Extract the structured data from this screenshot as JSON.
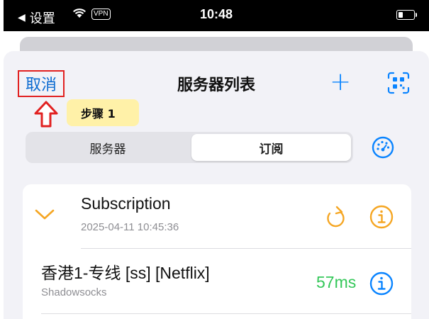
{
  "status_bar": {
    "back_label": "设置",
    "vpn_label": "VPN",
    "time": "10:48",
    "icons": [
      "back-triangle-icon",
      "wifi-icon",
      "vpn-icon",
      "battery-icon"
    ]
  },
  "nav": {
    "cancel_label": "取消",
    "title": "服务器列表",
    "add_icon": "plus-icon",
    "qr_icon": "qr-scan-icon"
  },
  "annotation": {
    "step_label": "步骤 1",
    "arrow_icon": "arrow-up-outline-icon",
    "highlight_color": "#e12121",
    "badge_color": "#fff1a8"
  },
  "segment": {
    "options": [
      "服务器",
      "订阅"
    ],
    "selected": "订阅",
    "speed_test_icon": "speedometer-icon"
  },
  "subscription": {
    "name": "Subscription",
    "updated": "2025-04-11 10:45:36",
    "expanded": true,
    "icons": [
      "chevron-down-icon",
      "refresh-icon",
      "info-icon"
    ],
    "accent_color": "#f5a623"
  },
  "servers": [
    {
      "name": "香港1-专线 [ss] [Netflix]",
      "protocol": "Shadowsocks",
      "latency": "57ms",
      "latency_color": "#34c759",
      "info_icon": "info-icon"
    }
  ],
  "colors": {
    "link_blue": "#0a6ad0",
    "accent_blue": "#0a84ff",
    "sheet_bg": "#f2f2f7"
  }
}
